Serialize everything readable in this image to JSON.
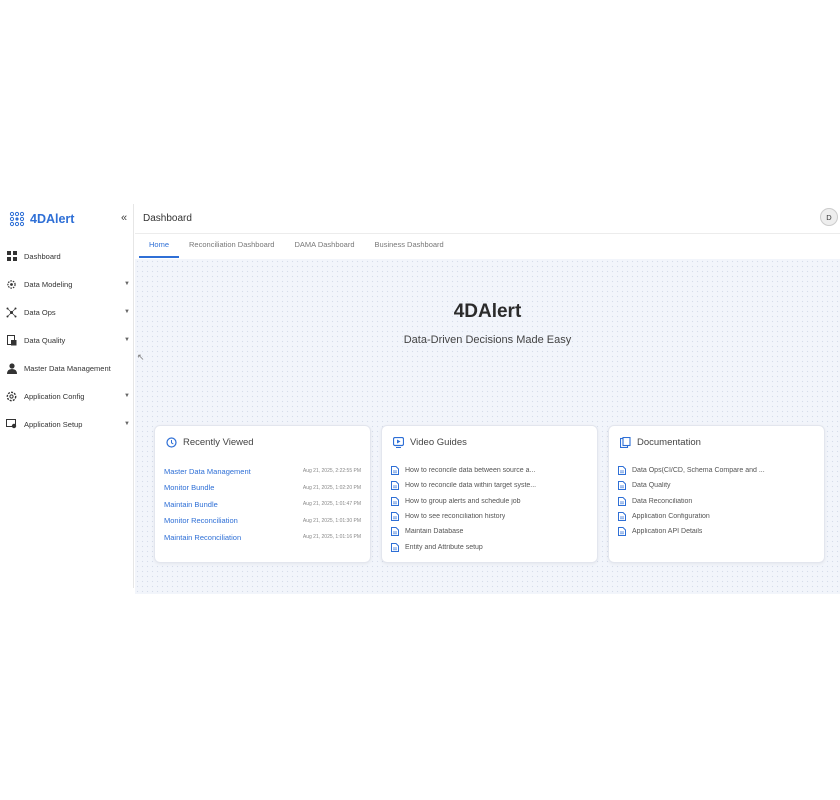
{
  "brand": {
    "name": "4DAlert"
  },
  "sidebar": {
    "collapse_label": "«",
    "items": [
      {
        "label": "Dashboard",
        "icon": "grid-icon",
        "has_children": false
      },
      {
        "label": "Data Modeling",
        "icon": "gear-icon",
        "has_children": true
      },
      {
        "label": "Data Ops",
        "icon": "network-icon",
        "has_children": true
      },
      {
        "label": "Data Quality",
        "icon": "document-check-icon",
        "has_children": true
      },
      {
        "label": "Master Data Management",
        "icon": "user-icon",
        "has_children": false
      },
      {
        "label": "Application Config",
        "icon": "settings-icon",
        "has_children": true
      },
      {
        "label": "Application Setup",
        "icon": "setup-icon",
        "has_children": true
      }
    ]
  },
  "header": {
    "title": "Dashboard",
    "avatar_initial": "D"
  },
  "tabs": [
    {
      "label": "Home",
      "active": true
    },
    {
      "label": "Reconciliation Dashboard",
      "active": false
    },
    {
      "label": "DAMA Dashboard",
      "active": false
    },
    {
      "label": "Business Dashboard",
      "active": false
    }
  ],
  "hero": {
    "title": "4DAlert",
    "subtitle": "Data-Driven Decisions Made Easy"
  },
  "recently_viewed": {
    "title": "Recently Viewed",
    "items": [
      {
        "label": "Master Data Management",
        "date": "Aug 21, 2025, 2:22:55 PM"
      },
      {
        "label": "Monitor Bundle",
        "date": "Aug 21, 2025, 1:02:20 PM"
      },
      {
        "label": "Maintain Bundle",
        "date": "Aug 21, 2025, 1:01:47 PM"
      },
      {
        "label": "Monitor Reconciliation",
        "date": "Aug 21, 2025, 1:01:30 PM"
      },
      {
        "label": "Maintain Reconciliation",
        "date": "Aug 21, 2025, 1:01:16 PM"
      }
    ]
  },
  "video_guides": {
    "title": "Video Guides",
    "items": [
      "How to reconcile data between source a...",
      "How to reconcile data within target syste...",
      "How to group alerts and schedule job",
      "How to see reconciliation history",
      "Maintain Database",
      "Entity and Attribute setup"
    ]
  },
  "documentation": {
    "title": "Documentation",
    "items": [
      "Data Ops(CI/CD, Schema Compare and ...",
      "Data Quality",
      "Data Reconciliation",
      "Application Configuration",
      "Application API Details"
    ]
  },
  "colors": {
    "accent": "#2e6fd6",
    "background": "#f2f5fb"
  }
}
